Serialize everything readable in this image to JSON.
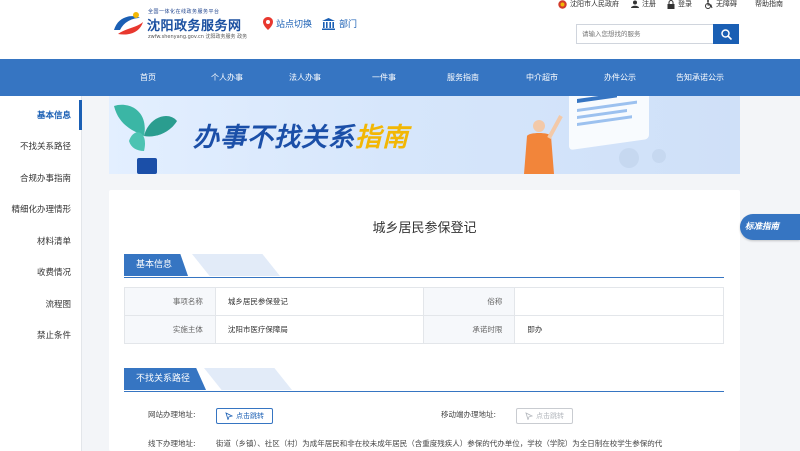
{
  "header": {
    "logo_top": "全国一体化在线政务服务平台",
    "logo_name": "沈阳政务服务网",
    "logo_sub": "zwfw.shenyang.gov.cn 沈阳政务服务 政务",
    "site_switch": "站点切换",
    "dept": "部门",
    "toplinks": {
      "gov": "沈阳市人民政府",
      "register": "注册",
      "login": "登录",
      "accessible": "无障碍",
      "help": "帮助指南"
    },
    "search_placeholder": "请输入您想找的服务"
  },
  "nav": [
    "首页",
    "个人办事",
    "法人办事",
    "一件事",
    "服务指南",
    "中介超市",
    "办件公示",
    "告知承诺公示"
  ],
  "sidebar": [
    "基本信息",
    "不找关系路径",
    "合规办事指南",
    "精细化办理情形",
    "材料清单",
    "收费情况",
    "流程图",
    "禁止条件"
  ],
  "banner": {
    "title_main": "办事不找关系",
    "title_highlight": "指南"
  },
  "main": {
    "title": "城乡居民参保登记",
    "sections": {
      "basic": "基本信息",
      "path": "不找关系路径"
    },
    "basic_info": [
      {
        "label": "事项名称",
        "value": "城乡居民参保登记",
        "label2": "俗称",
        "value2": ""
      },
      {
        "label": "实施主体",
        "value": "沈阳市医疗保障局",
        "label2": "承诺时限",
        "value2": "即办"
      }
    ],
    "path": {
      "web_label": "网站办理地址:",
      "web_btn": "点击跳转",
      "mobile_label": "移动端办理地址:",
      "mobile_btn": "点击跳转",
      "offline_label": "线下办理地址:",
      "offline_text": "街道（乡镇）、社区（村）为成年居民和非在校未成年居民（含重度残疾人）参保的代办单位，学校（学院）为全日制在校学生参保的代"
    },
    "std_badge": "标准指南"
  },
  "colors": {
    "primary": "#3675c2",
    "nav": "#3675c2",
    "highlight": "#f2b705"
  }
}
